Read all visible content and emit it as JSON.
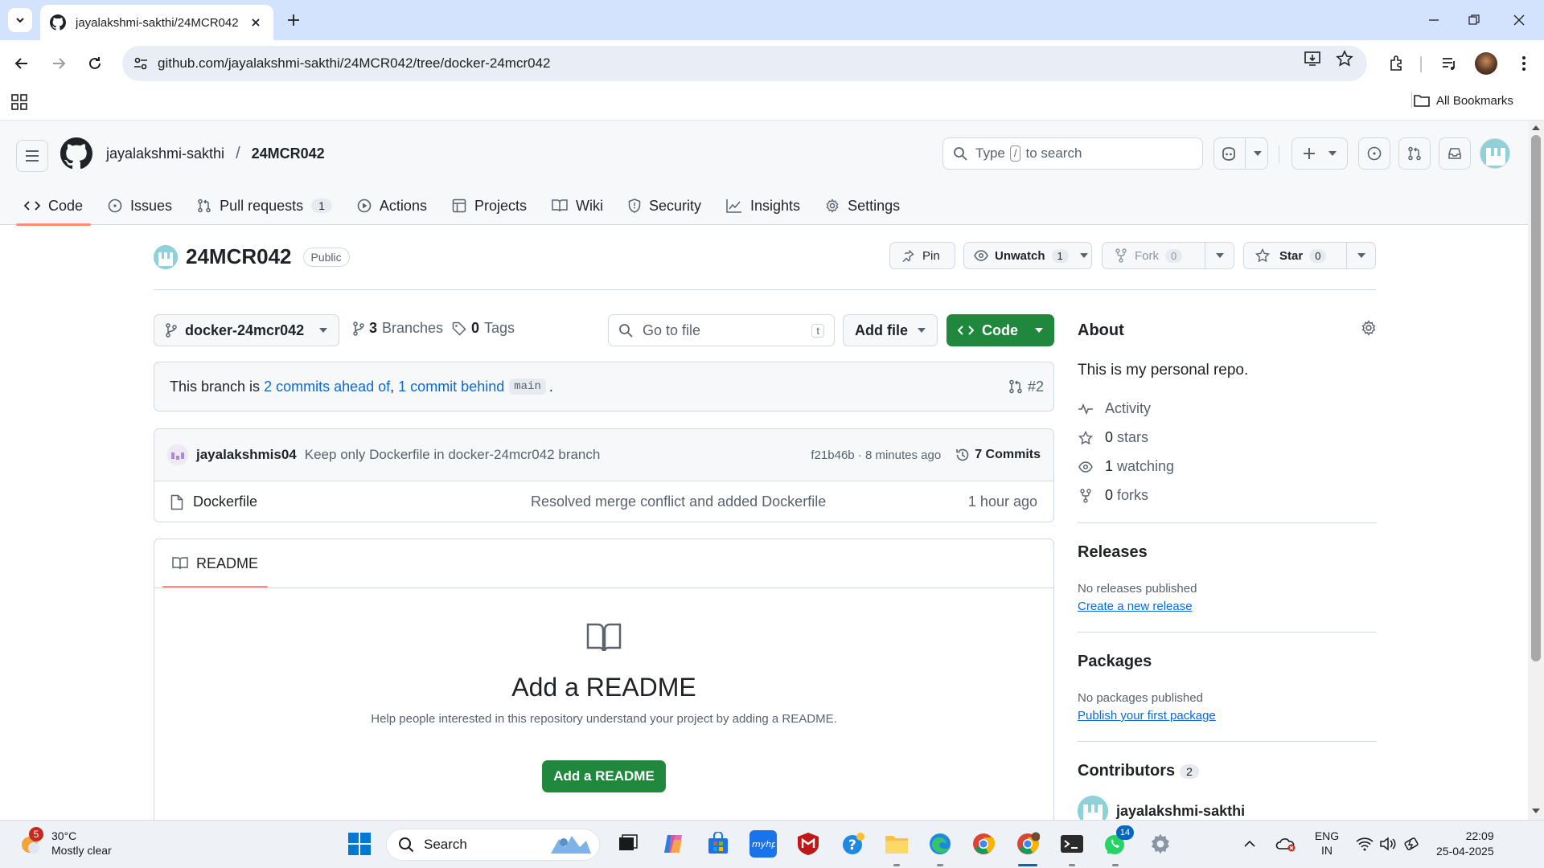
{
  "browser": {
    "tab_title": "jayalakshmi-sakthi/24MCR042 a",
    "url": "github.com/jayalakshmi-sakthi/24MCR042/tree/docker-24mcr042",
    "all_bookmarks": "All Bookmarks"
  },
  "header": {
    "owner": "jayalakshmi-sakthi",
    "separator": "/",
    "repo": "24MCR042",
    "search_prefix": "Type",
    "search_key": "/",
    "search_suffix": "to search"
  },
  "repo_nav": [
    {
      "label": "Code",
      "icon": "code-icon",
      "active": true
    },
    {
      "label": "Issues",
      "icon": "issue-icon"
    },
    {
      "label": "Pull requests",
      "icon": "pull-request-icon",
      "count": "1"
    },
    {
      "label": "Actions",
      "icon": "play-icon"
    },
    {
      "label": "Projects",
      "icon": "table-icon"
    },
    {
      "label": "Wiki",
      "icon": "book-icon"
    },
    {
      "label": "Security",
      "icon": "shield-icon"
    },
    {
      "label": "Insights",
      "icon": "graph-icon"
    },
    {
      "label": "Settings",
      "icon": "gear-icon"
    }
  ],
  "repo": {
    "name": "24MCR042",
    "visibility": "Public",
    "pin": "Pin",
    "unwatch": "Unwatch",
    "watch_count": "1",
    "fork": "Fork",
    "fork_count": "0",
    "star": "Star",
    "star_count": "0"
  },
  "main": {
    "branch": "docker-24mcr042",
    "branches_count": "3",
    "branches_label": "Branches",
    "tags_count": "0",
    "tags_label": "Tags",
    "goto_placeholder": "Go to file",
    "goto_key": "t",
    "add_file": "Add file",
    "code_btn": "Code",
    "ahead_prefix": "This branch is",
    "ahead_link": "2 commits ahead of",
    "comma": ",",
    "behind_link": "1 commit behind",
    "base_branch": "main",
    "period": ".",
    "pr_ref": "#2",
    "commit": {
      "author": "jayalakshmis04",
      "message": "Keep only Dockerfile in docker-24mcr042 branch",
      "sha_time": "f21b46b · 8 minutes ago",
      "commits": "7 Commits"
    },
    "files": [
      {
        "name": "Dockerfile",
        "message": "Resolved merge conflict and added Dockerfile",
        "age": "1 hour ago"
      }
    ],
    "readme": {
      "tab": "README",
      "heading": "Add a README",
      "text": "Help people interested in this repository understand your project by adding a README.",
      "button": "Add a README"
    }
  },
  "sidebar": {
    "about_title": "About",
    "description": "This is my personal repo.",
    "activity": "Activity",
    "stars_count": "0",
    "stars_label": "stars",
    "watching_count": "1",
    "watching_label": "watching",
    "forks_count": "0",
    "forks_label": "forks",
    "releases_title": "Releases",
    "releases_none": "No releases published",
    "releases_link": "Create a new release",
    "packages_title": "Packages",
    "packages_none": "No packages published",
    "packages_link": "Publish your first package",
    "contributors_title": "Contributors",
    "contributors_count": "2",
    "contributor_name": "jayalakshmi-sakthi"
  },
  "taskbar": {
    "weather_badge": "5",
    "temp": "30°C",
    "condition": "Mostly clear",
    "search": "Search",
    "whatsapp_badge": "14",
    "lang_top": "ENG",
    "lang_bottom": "IN",
    "time": "22:09",
    "date": "25-04-2025"
  },
  "colors": {
    "accent_green": "#1f883d",
    "link_blue": "#0969da",
    "tab_underline": "#fd8c73",
    "chrome_tabstrip": "#d3e3fd"
  }
}
